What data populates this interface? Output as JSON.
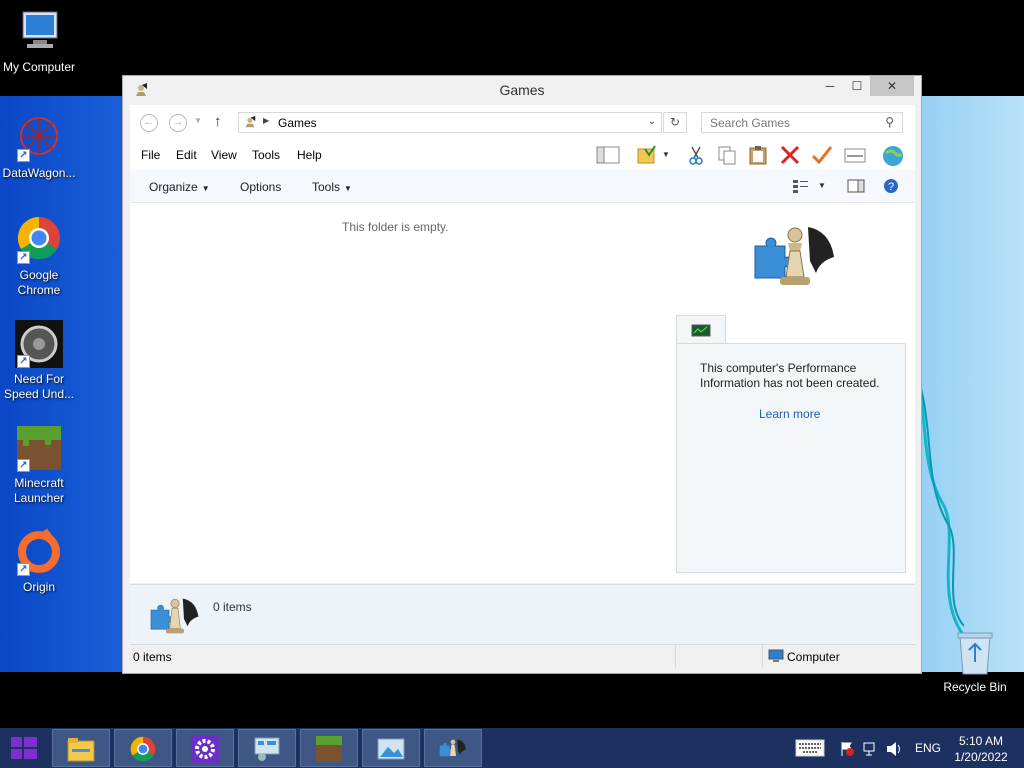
{
  "desktop": {
    "icons": [
      {
        "label": "My Computer"
      },
      {
        "label": "DataWagon..."
      },
      {
        "label": "Google Chrome"
      },
      {
        "label": "Need For Speed Und..."
      },
      {
        "label": "Minecraft Launcher"
      },
      {
        "label": "Origin"
      }
    ],
    "recycle_bin": "Recycle Bin"
  },
  "window": {
    "title": "Games",
    "address": {
      "path": "Games"
    },
    "search": {
      "placeholder": "Search Games"
    },
    "menu": [
      "File",
      "Edit",
      "View",
      "Tools",
      "Help"
    ],
    "commands": {
      "organize": "Organize",
      "options": "Options",
      "tools": "Tools"
    },
    "content": {
      "empty_message": "This folder is empty.",
      "perf_text": "This computer's Performance Information has not been created.",
      "learn_more": "Learn more"
    },
    "details": {
      "count": "0 items"
    },
    "status": {
      "items": "0 items",
      "location": "Computer"
    }
  },
  "taskbar": {
    "language": "ENG",
    "time": "5:10 AM",
    "date": "1/20/2022"
  },
  "colors": {
    "wallpaper_left": "#0a47c6",
    "taskbar": "#1d3160",
    "link": "#1f5fb0"
  }
}
